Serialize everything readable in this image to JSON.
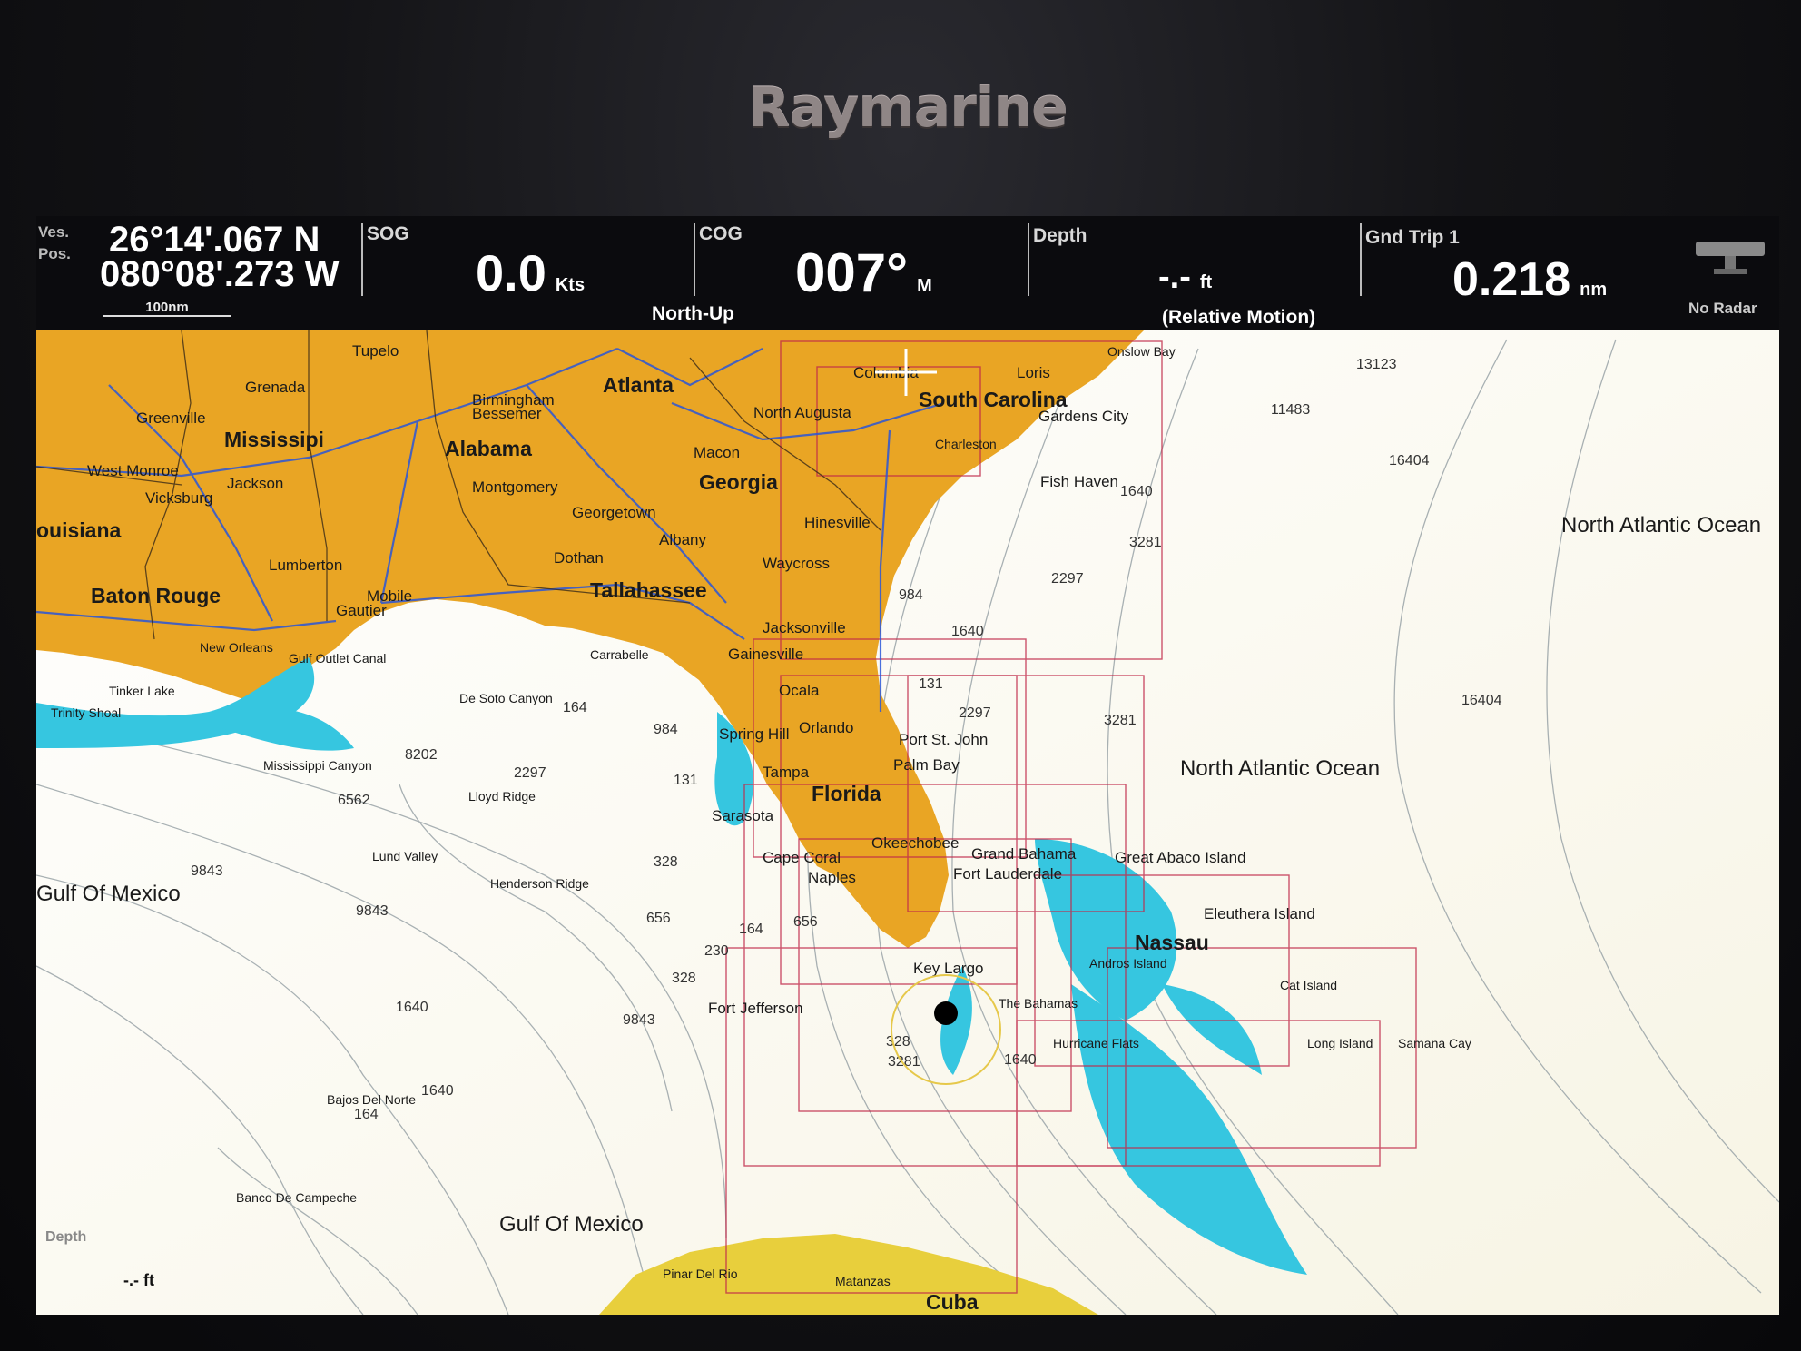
{
  "device": {
    "brand": "Raymarine"
  },
  "databar": {
    "position": {
      "label_top": "Ves.",
      "label_bottom": "Pos.",
      "lat": "26°14'.067 N",
      "lon": "080°08'.273 W",
      "scale": "100nm"
    },
    "sog": {
      "label": "SOG",
      "value": "0.0",
      "unit": "Kts"
    },
    "cog": {
      "label": "COG",
      "value": "007°",
      "unit": "M",
      "mode": "North-Up"
    },
    "depth": {
      "label": "Depth",
      "value": "-.-",
      "unit": "ft",
      "mode": "(Relative Motion)"
    },
    "trip": {
      "label": "Gnd Trip 1",
      "value": "0.218",
      "unit": "nm"
    },
    "radar": {
      "label": "No Radar",
      "icon": "radar-icon"
    }
  },
  "map": {
    "colors": {
      "land": "#e8a824",
      "water": "#ffffff",
      "shallow": "#36c6e0",
      "chart_border": "#c02a4a",
      "roads": "#2a56d8",
      "borders": "#3a2a18"
    },
    "states": [
      "Mississipi",
      "Alabama",
      "Georgia",
      "South Carolina",
      "Florida",
      "ouisiana"
    ],
    "cities": [
      "Atlanta",
      "Tallahassee",
      "Baton Rouge",
      "Columbia",
      "North Augusta",
      "Macon",
      "Montgomery",
      "Birmingham",
      "Bessemer",
      "Jackson",
      "Vicksburg",
      "West Monroe",
      "Greenville",
      "Grenada",
      "Tupelo",
      "Lumberton",
      "Mobile",
      "Gautier",
      "Dothan",
      "Albany",
      "Georgetown",
      "Waycross",
      "Hinesville",
      "Jacksonville",
      "Gainesville",
      "Ocala",
      "Orlando",
      "Spring Hill",
      "Tampa",
      "Sarasota",
      "Cape Coral",
      "Naples",
      "Okeechobee",
      "Port St. John",
      "Palm Bay",
      "Fort Lauderdale",
      "Key Largo",
      "Nassau",
      "Loris",
      "Gardens City",
      "Fish Haven",
      "New Orleans",
      "Carrabelle",
      "Fort Jefferson",
      "Gulf Outlet Canal",
      "Tinker Lake",
      "Trinity Shoal",
      "Grand Bahama",
      "Great Abaco Island",
      "Eleuthera Island",
      "Cat Island",
      "Long Island",
      "Samana Cay",
      "Andros Island",
      "Hurricane Flats",
      "The Bahamas",
      "Cuba",
      "Matanzas",
      "Onslow Bay",
      "Charleston"
    ],
    "features": [
      "De Soto Canyon",
      "Mississippi Canyon",
      "Lloyd Ridge",
      "Lund Valley",
      "Henderson Ridge",
      "Bajos Del Norte",
      "Banco De Campeche",
      "Pinar Del Rio"
    ],
    "oceans": [
      "North Atlantic Ocean",
      "North Atlantic Ocean",
      "Gulf Of Mexico",
      "Gulf Of Mexico"
    ],
    "depths": [
      "13123",
      "11483",
      "16404",
      "16404",
      "3281",
      "3281",
      "2297",
      "2297",
      "2297",
      "1640",
      "1640",
      "1640",
      "1640",
      "984",
      "984",
      "656",
      "656",
      "328",
      "328",
      "328",
      "164",
      "164",
      "164",
      "131",
      "230",
      "6562",
      "8202",
      "9843",
      "9843",
      "9843",
      "3281",
      "131",
      "1640"
    ],
    "bottom_left": {
      "label": "Depth",
      "value": "-.-",
      "unit": "ft"
    }
  }
}
